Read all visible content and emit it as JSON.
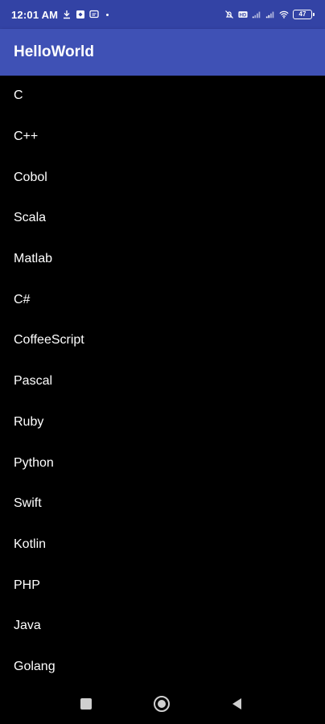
{
  "status_bar": {
    "time": "12:01 AM",
    "left_icons": [
      "download-icon",
      "notification-app-icon",
      "message-icon",
      "dot-icon"
    ],
    "right_icons": [
      "alarm-off-icon",
      "hd-icon",
      "signal-icon",
      "signal-icon",
      "wifi-icon"
    ],
    "battery": "47",
    "background": "#3343A5"
  },
  "app_bar": {
    "title": "HelloWorld",
    "background": "#3F51B5"
  },
  "list": {
    "items": [
      "C",
      "C++",
      "Cobol",
      "Scala",
      "Matlab",
      "C#",
      "CoffeeScript",
      "Pascal",
      "Ruby",
      "Python",
      "Swift",
      "Kotlin",
      "PHP",
      "Java",
      "Golang"
    ]
  },
  "nav_bar": {
    "buttons": [
      "recents-icon",
      "home-icon",
      "back-icon"
    ]
  }
}
